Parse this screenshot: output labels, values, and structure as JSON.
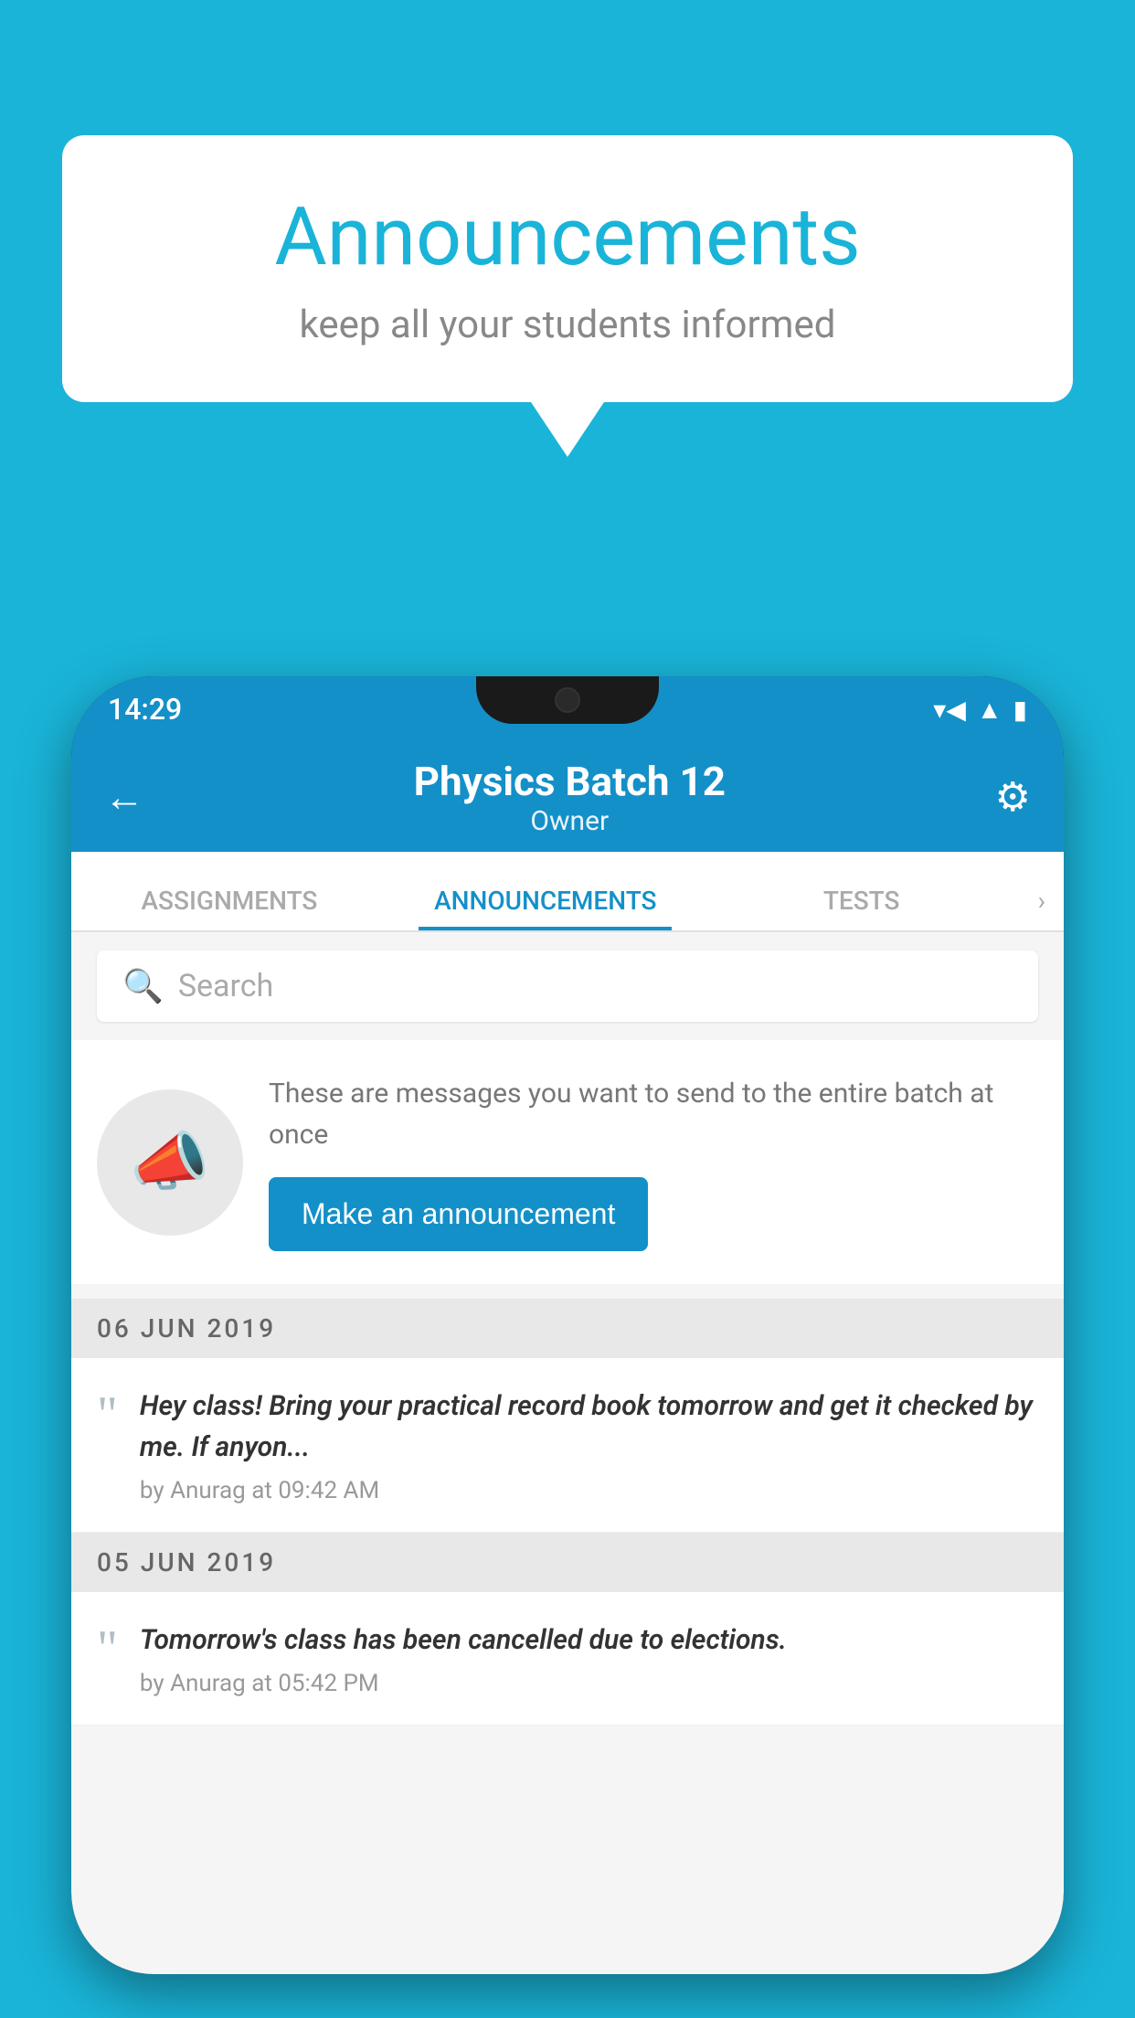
{
  "background_color": "#1ab4d8",
  "speech_bubble": {
    "title": "Announcements",
    "subtitle": "keep all your students informed"
  },
  "phone": {
    "status_bar": {
      "time": "14:29",
      "wifi": "▼",
      "signal": "▲",
      "battery": "▮"
    },
    "header": {
      "back_label": "←",
      "title": "Physics Batch 12",
      "subtitle": "Owner",
      "gear_label": "⚙"
    },
    "tabs": [
      {
        "label": "ASSIGNMENTS",
        "active": false
      },
      {
        "label": "ANNOUNCEMENTS",
        "active": true
      },
      {
        "label": "TESTS",
        "active": false
      }
    ],
    "search": {
      "placeholder": "Search"
    },
    "cta": {
      "description": "These are messages you want to send to the entire batch at once",
      "button_label": "Make an announcement"
    },
    "announcements": [
      {
        "date": "06  JUN  2019",
        "text": "Hey class! Bring your practical record book tomorrow and get it checked by me. If anyon...",
        "meta": "by Anurag at 09:42 AM"
      },
      {
        "date": "05  JUN  2019",
        "text": "Tomorrow's class has been cancelled due to elections.",
        "meta": "by Anurag at 05:42 PM"
      }
    ]
  }
}
